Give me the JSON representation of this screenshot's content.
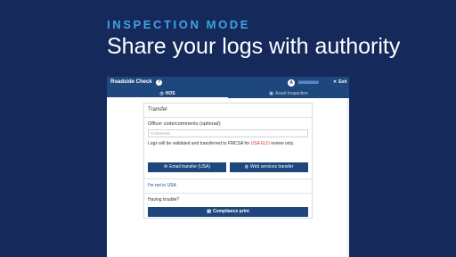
{
  "promo": {
    "kicker": "INSPECTION MODE",
    "headline": "Share your logs with authority"
  },
  "appbar": {
    "title": "Roadside Check",
    "help_glyph": "?",
    "avatar_letter": "A",
    "exit_label": "Exit"
  },
  "tabs": [
    {
      "label": "HOS",
      "active": true
    },
    {
      "label": "Asset Inspection",
      "active": false
    }
  ],
  "transfer": {
    "title": "Transfer",
    "field_label": "Officer code/comments (optional):",
    "comments_placeholder": "Comments",
    "note_prefix": "Logs will be validated and transferred to FMCSA for",
    "note_highlight": "USA ELD",
    "note_suffix": "review only.",
    "email_button": "Email transfer (USA)",
    "web_button": "Web services transfer",
    "not_in_usa_link": "I'm not in USA",
    "trouble_text": "Having trouble?",
    "compliance_button": "Compliance print"
  },
  "colors": {
    "background": "#152a5a",
    "accent": "#3ea3e6",
    "appbar": "#1d477d",
    "highlight_red": "#d9372b"
  },
  "icons": {
    "help": "help-icon",
    "exit": "close-icon",
    "hos": "clock-icon",
    "asset": "inspection-icon",
    "email": "envelope-icon",
    "web": "globe-icon",
    "print": "document-icon"
  }
}
